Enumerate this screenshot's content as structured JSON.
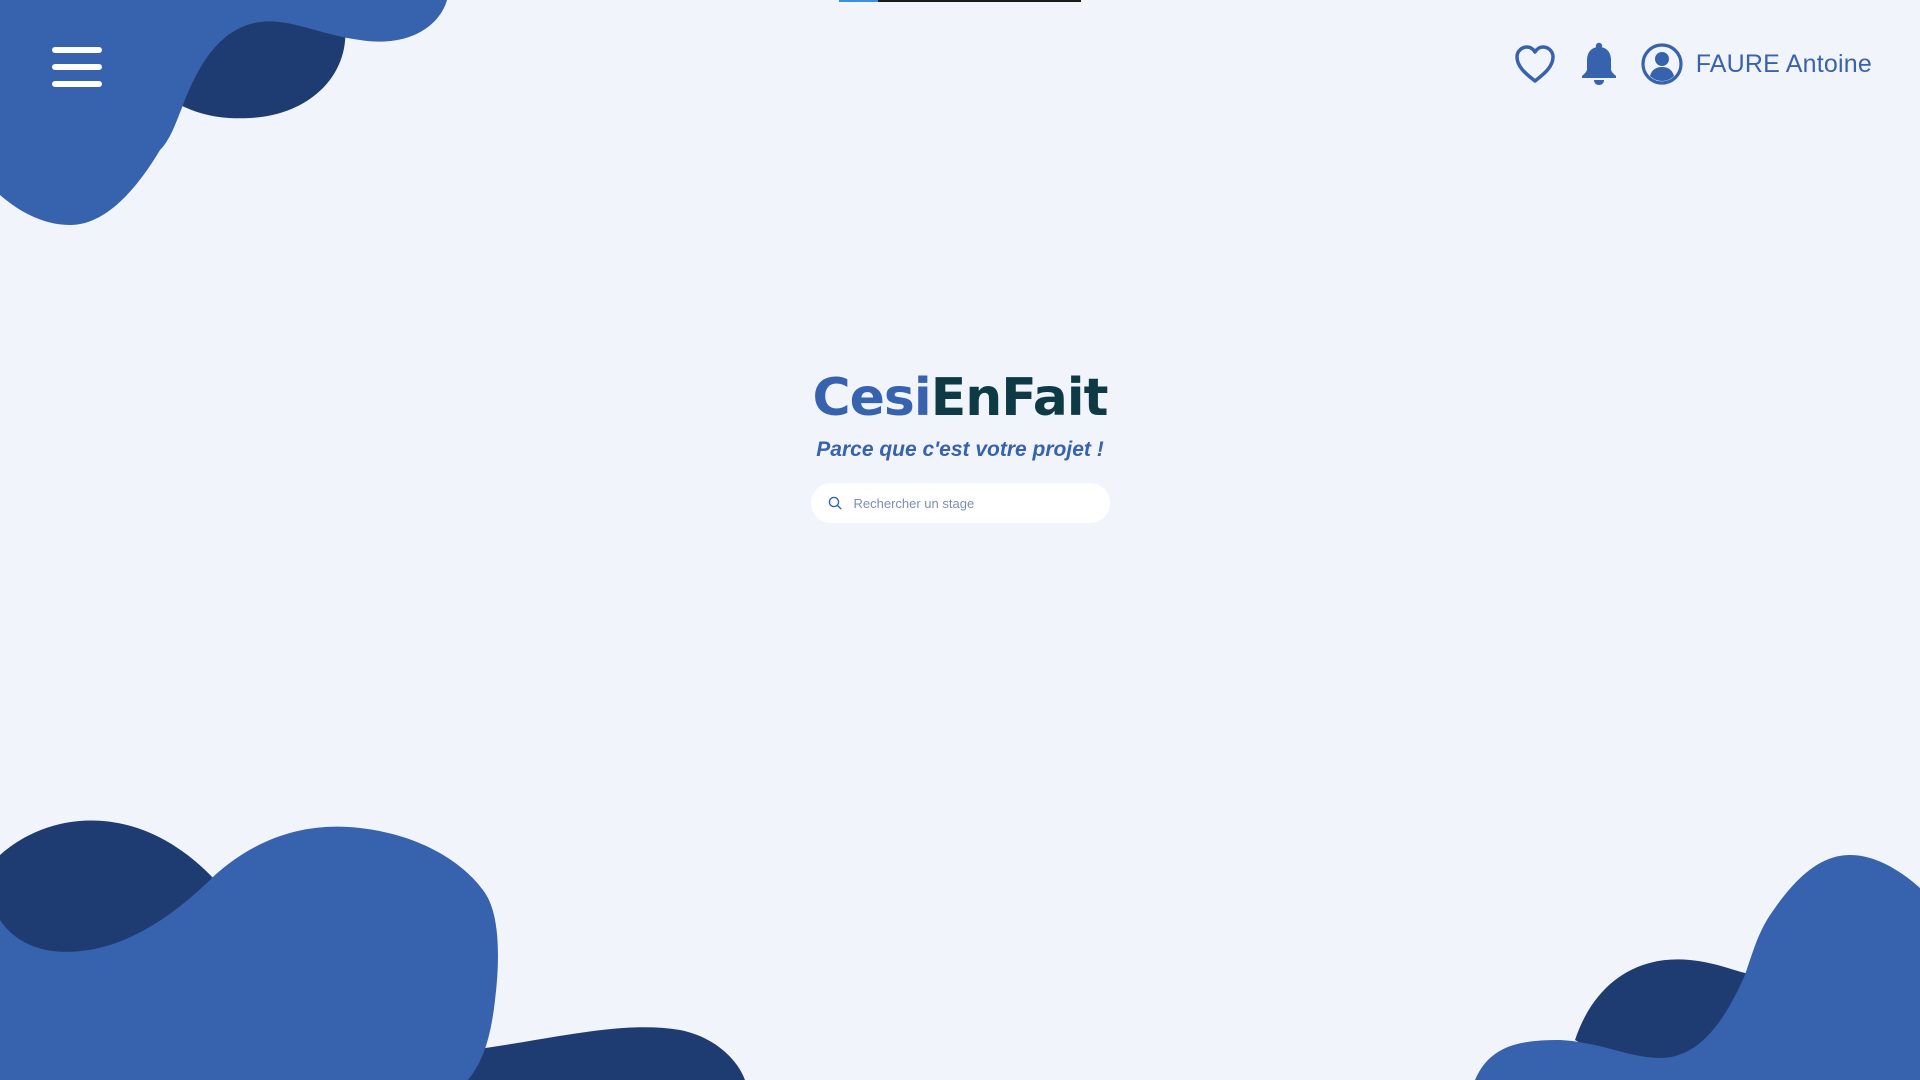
{
  "colors": {
    "background": "#f2f4fc",
    "blob_primary": "#3662ae",
    "blob_dark": "#1e3c72",
    "brand_blue": "#3662ae",
    "brand_dark": "#0e3a45"
  },
  "header": {
    "menu_icon": "hamburger-menu-icon",
    "favorites_icon": "heart-icon",
    "notifications_icon": "bell-icon",
    "user_icon": "user-circle-icon",
    "user_name": "FAURE Antoine"
  },
  "top_loading_bar": {
    "progress_fraction": 0.16
  },
  "hero": {
    "logo_part_a": "Cesi",
    "logo_part_b": "EnFait",
    "tagline": "Parce que c'est votre projet !"
  },
  "search": {
    "icon": "search-icon",
    "placeholder": "Rechercher un stage",
    "value": ""
  }
}
